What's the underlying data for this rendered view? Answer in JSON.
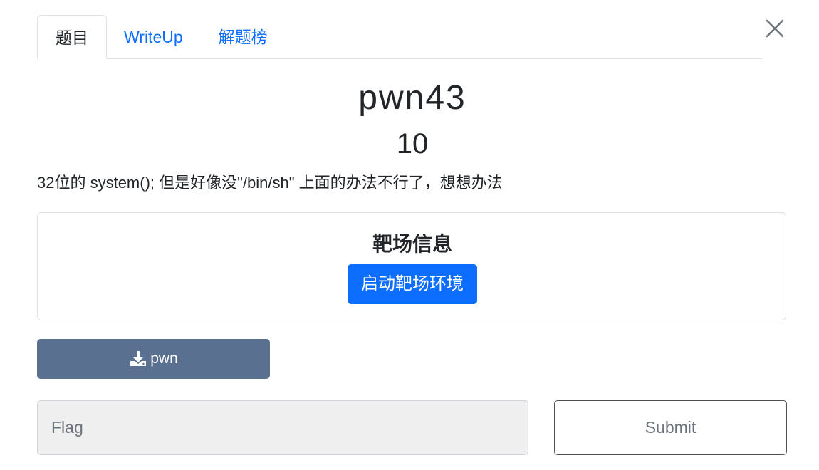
{
  "tabs": [
    {
      "label": "题目",
      "active": true
    },
    {
      "label": "WriteUp",
      "active": false
    },
    {
      "label": "解题榜",
      "active": false
    }
  ],
  "challenge": {
    "name": "pwn43",
    "points": "10",
    "description": "32位的 system(); 但是好像没\"/bin/sh\" 上面的办法不行了，想想办法"
  },
  "environment": {
    "title": "靶场信息",
    "start_button": "启动靶场环境"
  },
  "download": {
    "icon": "download-icon",
    "label": "pwn"
  },
  "flag_form": {
    "placeholder": "Flag",
    "value": "",
    "submit_label": "Submit"
  },
  "colors": {
    "primary": "#0d6efd",
    "download_button": "#5a7090",
    "input_background": "#efefef"
  }
}
